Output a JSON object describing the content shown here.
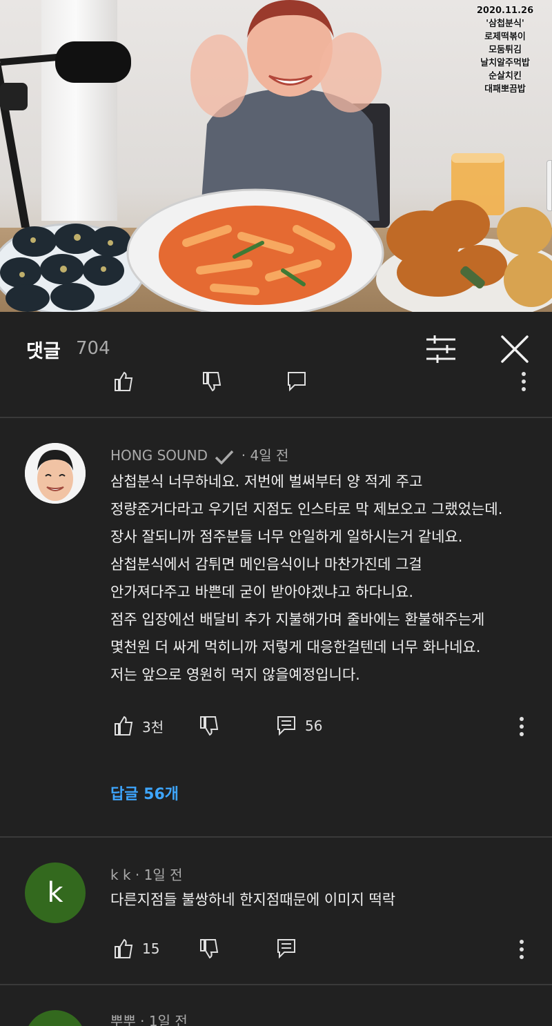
{
  "video": {
    "overlay_lines": [
      "2020.11.26",
      "'삼첩분식'",
      "로제떡볶이",
      "모둠튀김",
      "날치알주먹밥",
      "순살치킨",
      "대패뽀끔밥"
    ]
  },
  "comments_panel": {
    "title": "댓글",
    "count": "704",
    "filter_icon": "sort-filter-icon",
    "close_icon": "close-icon"
  },
  "comments": [
    {
      "author": "HONG SOUND",
      "verified": true,
      "time": "4일 전",
      "lines": [
        "삼첩분식 너무하네요. 저번에 벌써부터 양 적게 주고",
        "정량준거다라고 우기던 지점도 인스타로 막 제보오고 그랬었는데.",
        "장사 잘되니까 점주분들 너무 안일하게 일하시는거 같네요.",
        "삼첩분식에서 감튀면 메인음식이나 마찬가진데 그걸",
        "안가져다주고 바쁜데 굳이 받아야겠냐고 하다니요.",
        "점주 입장에선 배달비 추가 지불해가며 줄바에는 환불해주는게",
        "몇천원 더 싸게 먹히니까 저렇게 대응한걸텐데 너무 화나네요.",
        "저는 앞으로 영원히 먹지 않을예정입니다."
      ],
      "likes": "3천",
      "reply_count": "56",
      "replies_link": "답글 56개"
    },
    {
      "author": "k k",
      "avatar_letter": "k",
      "time": "1일 전",
      "lines": [
        "다른지점들 불쌍하네 한지점때문에 이미지 떡락"
      ],
      "likes": "15",
      "reply_count": ""
    },
    {
      "author": "뿌뿌",
      "time": "1일 전"
    }
  ],
  "colors": {
    "background": "#212121",
    "divider": "#3a3a3a",
    "link": "#3ea6ff",
    "avatar_k": "#33691e"
  },
  "icons": {
    "like": "thumbs-up-icon",
    "dislike": "thumbs-down-icon",
    "reply": "reply-comment-icon",
    "more": "vertical-dots-icon",
    "verified": "checkmark-icon"
  }
}
